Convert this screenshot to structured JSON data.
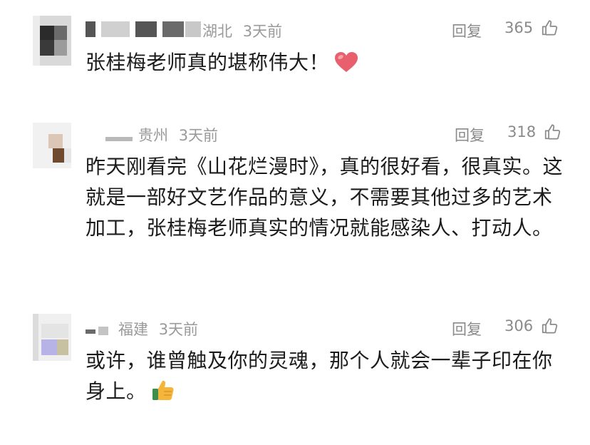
{
  "comments": [
    {
      "location": "湖北",
      "time": "3天前",
      "reply_label": "回复",
      "likes": "365",
      "text": "张桂梅老师真的堪称伟大！",
      "emoji": "heart-emoji"
    },
    {
      "location": "贵州",
      "time": "3天前",
      "reply_label": "回复",
      "likes": "318",
      "text": "昨天刚看完《山花烂漫时》，真的很好看，很真实。这就是一部好文艺作品的意义，不需要其他过多的艺术加工，张桂梅老师真实的情况就能感染人、打动人。"
    },
    {
      "location": "福建",
      "time": "3天前",
      "reply_label": "回复",
      "likes": "306",
      "text": "或许，谁曾触及你的灵魂，那个人就会一辈子印在你身上。",
      "emoji": "thumbs-up-emoji"
    }
  ],
  "colors": {
    "meta": "#9a9a9a",
    "text": "#1c1c1c",
    "heart": "#e8606e",
    "thumb": "#f5b53b"
  }
}
